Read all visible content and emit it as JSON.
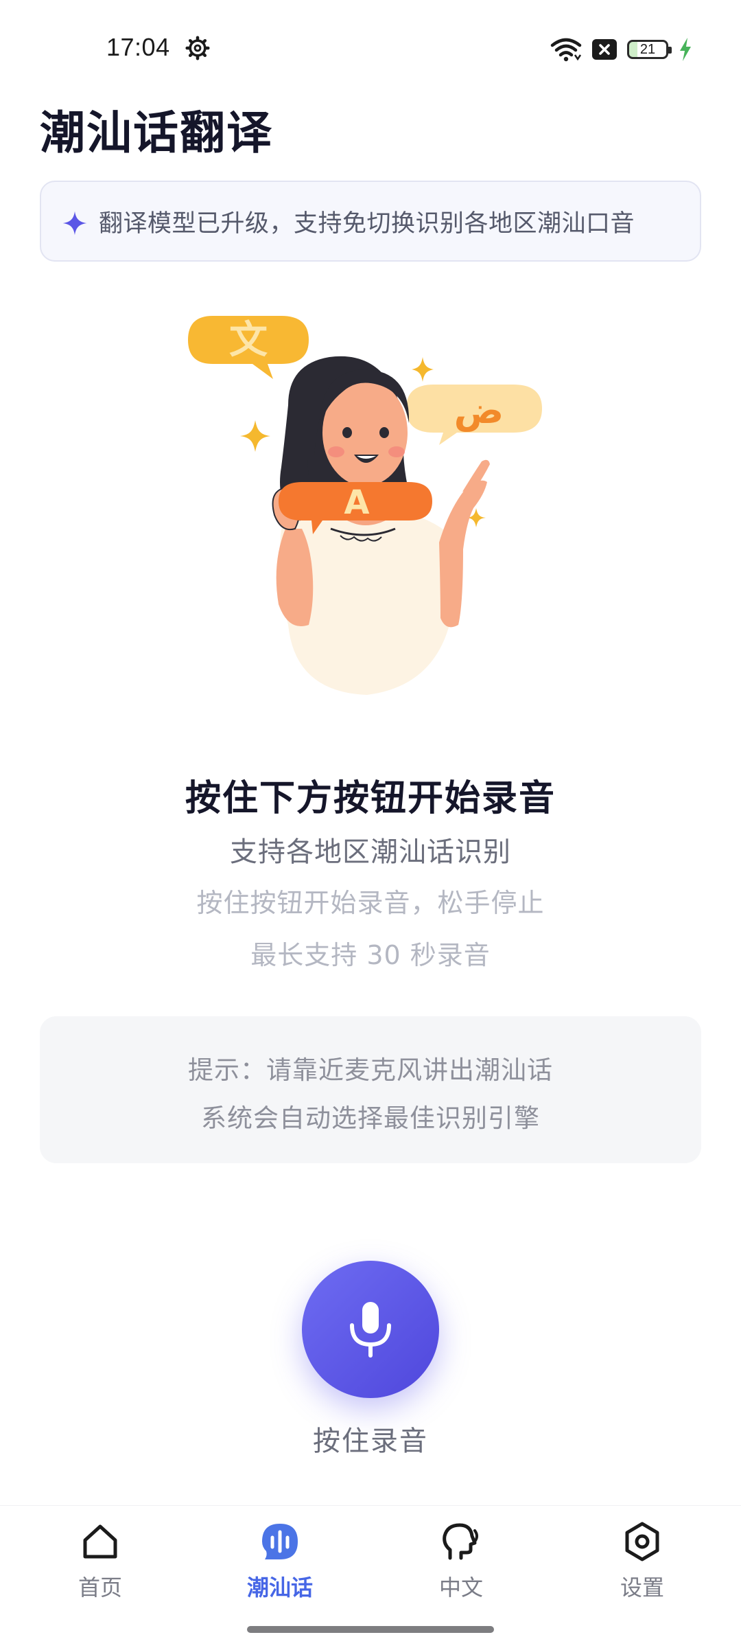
{
  "status_bar": {
    "time": "17:04",
    "battery_level": "21",
    "icons": [
      "gear-icon",
      "wifi-icon",
      "sim-off-icon",
      "battery-icon",
      "charging-bolt-icon"
    ]
  },
  "header": {
    "title": "潮汕话翻译"
  },
  "banner": {
    "icon": "sparkle-icon",
    "text": "翻译模型已升级，支持免切换识别各地区潮汕口音"
  },
  "illustration": {
    "bubble_chinese": "文",
    "bubble_arabic": "ض",
    "bubble_latin": "A"
  },
  "instructions": {
    "title": "按住下方按钮开始录音",
    "subtitle": "支持各地区潮汕话识别",
    "line1": "按住按钮开始录音，松手停止",
    "line2": "最长支持 30 秒录音"
  },
  "tip": {
    "line1": "提示：请靠近麦克风讲出潮汕话",
    "line2": "系统会自动选择最佳识别引擎"
  },
  "record": {
    "icon": "microphone-icon",
    "label": "按住录音"
  },
  "nav": {
    "active": "chaoshan",
    "items": [
      {
        "id": "home",
        "label": "首页",
        "icon": "home-icon"
      },
      {
        "id": "chaoshan",
        "label": "潮汕话",
        "icon": "voice-bubble-icon"
      },
      {
        "id": "chinese",
        "label": "中文",
        "icon": "speaking-head-icon"
      },
      {
        "id": "settings",
        "label": "设置",
        "icon": "hexagon-settings-icon"
      }
    ]
  },
  "colors": {
    "accent": "#5b56e6",
    "nav_active": "#4666e6",
    "title": "#15162a",
    "muted": "#b4b7c2"
  }
}
